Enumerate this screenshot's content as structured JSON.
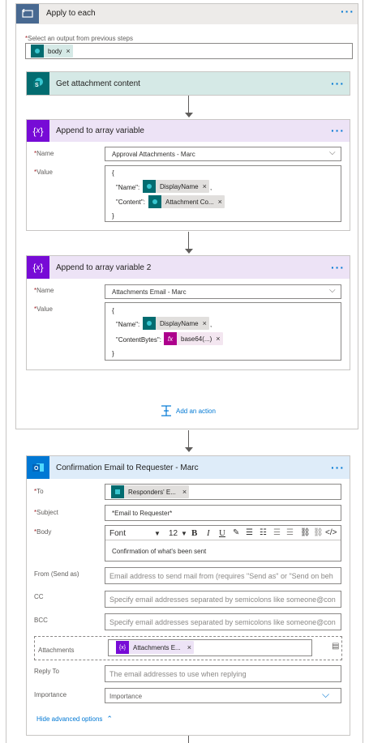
{
  "apply_each": {
    "title": "Apply to each",
    "select_label": "Select an output from previous steps",
    "token": "body"
  },
  "get_attachment": {
    "title": "Get attachment content"
  },
  "append1": {
    "title": "Append to array variable",
    "name_label": "Name",
    "name_value": "Approval Attachments - Marc",
    "value_label": "Value",
    "line_open": "{",
    "key1": "\"Name\":",
    "token1": "DisplayName",
    "comma": ",",
    "key2": "\"Content\":",
    "token2": "Attachment Co...",
    "line_close": "}"
  },
  "append2": {
    "title": "Append to array variable 2",
    "name_label": "Name",
    "name_value": "Attachments Email - Marc",
    "value_label": "Value",
    "line_open": "{",
    "key1": "\"Name\":",
    "token1": "DisplayName",
    "comma": ",",
    "key2": "\"ContentBytes\":",
    "token2": "base64(...)",
    "line_close": "}"
  },
  "add_action": "Add an action",
  "email": {
    "title": "Confirmation Email to Requester - Marc",
    "to_label": "To",
    "to_token": "Responders' E...",
    "subject_label": "Subject",
    "subject_value": "*Email to Requester*",
    "body_label": "Body",
    "font_select": "Font",
    "size_select": "12",
    "body_text": "Confirmation of what's been sent",
    "from_label": "From (Send as)",
    "from_placeholder": "Email address to send mail from (requires \"Send as\" or \"Send on beh",
    "cc_label": "CC",
    "cc_placeholder": "Specify email addresses separated by semicolons like someone@con",
    "bcc_label": "BCC",
    "bcc_placeholder": "Specify email addresses separated by semicolons like someone@con",
    "attachments_label": "Attachments",
    "attachments_token": "Attachments E...",
    "replyto_label": "Reply To",
    "replyto_placeholder": "The email addresses to use when replying",
    "importance_label": "Importance",
    "importance_value": "Importance",
    "hide_advanced": "Hide advanced options"
  },
  "colors": {
    "sharepoint": "#036c70",
    "variable": "#770bd6",
    "outlook": "#0078d4",
    "loop": "#486991"
  }
}
